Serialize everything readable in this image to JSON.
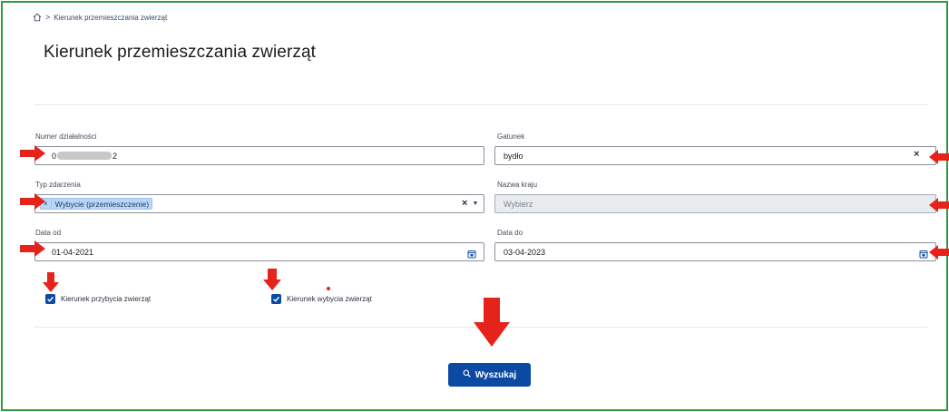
{
  "breadcrumb": {
    "home_icon": "home-icon",
    "separator": ">",
    "current": "Kierunek przemieszczania zwierząt"
  },
  "page": {
    "title": "Kierunek przemieszczania zwierząt"
  },
  "form": {
    "numer_dzialalnosci": {
      "label": "Numer działalności",
      "value_prefix": "0",
      "value_suffix": "2"
    },
    "gatunek": {
      "label": "Gatunek",
      "value": "bydło"
    },
    "typ_zdarzenia": {
      "label": "Typ zdarzenia",
      "chip_remove": "×",
      "chip_label": "Wybycie (przemieszczenie)"
    },
    "nazwa_kraju": {
      "label": "Nazwa kraju",
      "placeholder": "Wybierz"
    },
    "data_od": {
      "label": "Data od",
      "value": "01-04-2021"
    },
    "data_do": {
      "label": "Data do",
      "value": "03-04-2023"
    },
    "checkbox_przybycie": {
      "label": "Kierunek przybycia zwierząt",
      "checked": true
    },
    "checkbox_wybycie": {
      "label": "Kierunek wybycia zwierząt",
      "checked": true
    },
    "clear_symbol": "×",
    "caret_symbol": "▼"
  },
  "search": {
    "label": "Wyszukaj",
    "icon": "search-icon"
  },
  "colors": {
    "accent": "#0b4aa2",
    "frame": "#2e9c3a",
    "annotation_arrow": "#e5231b"
  }
}
